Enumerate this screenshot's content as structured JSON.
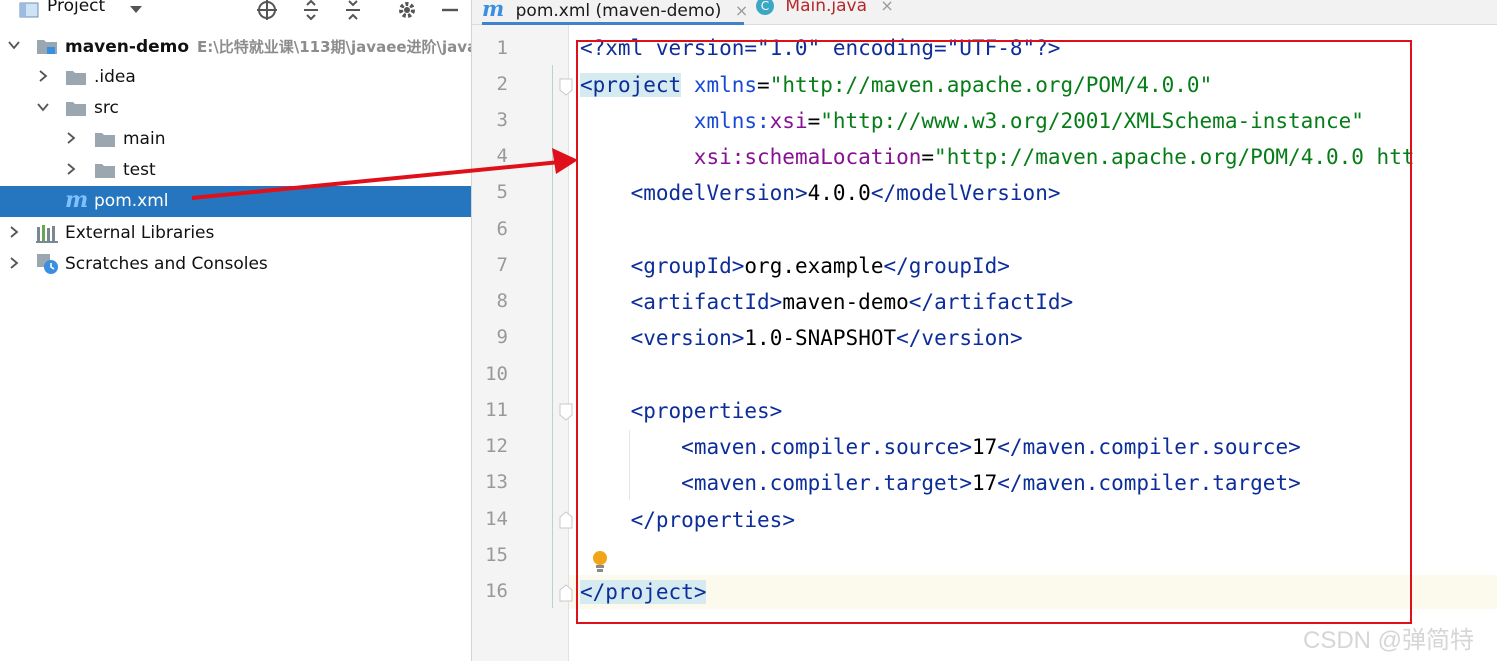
{
  "project_panel": {
    "title": "Project",
    "tree": [
      {
        "label": "maven-demo",
        "hint": "E:\\比特就业课\\113期\\javaee进阶\\java"
      },
      {
        "label": ".idea"
      },
      {
        "label": "src"
      },
      {
        "label": "main"
      },
      {
        "label": "test"
      },
      {
        "label": "pom.xml"
      },
      {
        "label": "External Libraries"
      },
      {
        "label": "Scratches and Consoles"
      }
    ],
    "file_badge": "m"
  },
  "editor": {
    "tabs": [
      {
        "label": "pom.xml (maven-demo)",
        "badge": "m"
      },
      {
        "label": "Main.java",
        "badge": "C"
      }
    ],
    "close_glyph": "×",
    "line_numbers": [
      "1",
      "2",
      "3",
      "4",
      "5",
      "6",
      "7",
      "8",
      "9",
      "10",
      "11",
      "12",
      "13",
      "14",
      "15",
      "16"
    ],
    "code": {
      "l1": "<?xml version=\"1.0\" encoding=\"UTF-8\"?>",
      "l2_tag": "project",
      "l2_attr": "xmlns",
      "l2_val": "\"http://maven.apache.org/POM/4.0.0\"",
      "l3_ns": "xmlns:",
      "l3_attr": "xsi",
      "l3_val": "\"http://www.w3.org/2001/XMLSchema-instance\"",
      "l4_ns": "xsi",
      "l4_attr": ":schemaLocation",
      "l4_val": "\"http://maven.apache.org/POM/4.0.0 htt",
      "modelVersion_tag": "modelVersion",
      "modelVersion_val": "4.0.0",
      "groupId_tag": "groupId",
      "groupId_val": "org.example",
      "artifactId_tag": "artifactId",
      "artifactId_val": "maven-demo",
      "version_tag": "version",
      "version_val": "1.0-SNAPSHOT",
      "properties_tag": "properties",
      "source_tag": "maven.compiler.source",
      "source_val": "17",
      "target_tag": "maven.compiler.target",
      "target_val": "17",
      "project_close_tag": "project"
    }
  },
  "watermark": "CSDN @弹简特",
  "colors": {
    "selection": "#2675bf",
    "annotation_red": "#e0101b",
    "tag_blue": "#0c2d9a",
    "value_green": "#067d17",
    "namespace_purple": "#871094"
  }
}
